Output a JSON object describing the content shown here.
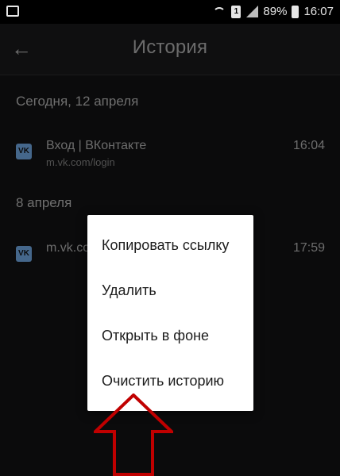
{
  "status_bar": {
    "battery_percent": "89%",
    "time": "16:07",
    "sim_label": "1"
  },
  "toolbar": {
    "title": "История",
    "back_icon": "arrow-left-icon"
  },
  "history": {
    "sections": [
      {
        "header": "Сегодня, 12 апреля",
        "items": [
          {
            "title": "Вход | ВКонтакте",
            "url": "m.vk.com/login",
            "time": "16:04",
            "icon": "vk-icon"
          }
        ]
      },
      {
        "header": "8 апреля",
        "items": [
          {
            "title": "m.vk.co",
            "time": "17:59",
            "icon": "vk-icon"
          }
        ]
      }
    ]
  },
  "context_menu": {
    "items": [
      "Копировать ссылку",
      "Удалить",
      "Открыть в фоне",
      "Очистить историю"
    ]
  },
  "annotation": {
    "arrow_color": "#c00000",
    "arrow_icon": "arrow-up-outline-icon"
  },
  "colors": {
    "background": "#0b0b0c",
    "menu_background": "#ffffff",
    "vk_blue": "#45678b"
  }
}
